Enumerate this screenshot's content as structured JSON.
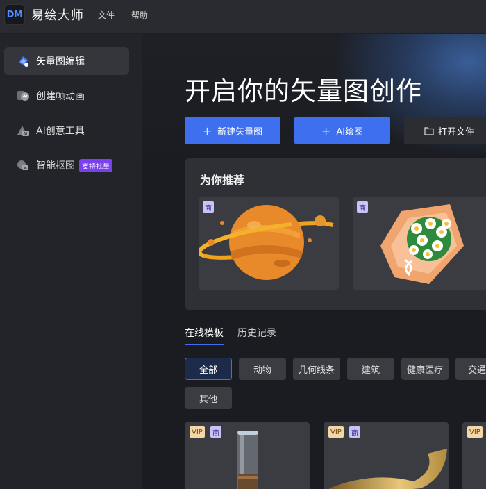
{
  "app": {
    "logo": "DM",
    "name": "易绘大师"
  },
  "menu": {
    "file": "文件",
    "help": "帮助"
  },
  "sidebar": {
    "items": [
      {
        "label": "矢量图编辑",
        "icon": "vector-edit-icon",
        "active": true
      },
      {
        "label": "创建帧动画",
        "icon": "frame-animation-icon",
        "active": false
      },
      {
        "label": "AI创意工具",
        "icon": "ai-tool-icon",
        "active": false
      },
      {
        "label": "智能抠图",
        "icon": "smart-cutout-icon",
        "active": false,
        "tag": "支持批量"
      }
    ]
  },
  "hero": {
    "title": "开启你的矢量图创作",
    "buttons": [
      {
        "label": "新建矢量图",
        "icon": "plus-icon"
      },
      {
        "label": "AI绘图",
        "icon": "plus-icon"
      },
      {
        "label": "打开文件",
        "icon": "folder-icon"
      }
    ]
  },
  "recommend": {
    "title": "为你推荐",
    "cards": [
      {
        "badge": "商",
        "image": "planet-illustration"
      },
      {
        "badge": "商",
        "image": "flower-bouquet-illustration"
      }
    ]
  },
  "tabs": [
    {
      "label": "在线模板",
      "active": true
    },
    {
      "label": "历史记录",
      "active": false
    }
  ],
  "categories": [
    "全部",
    "动物",
    "几何线条",
    "建筑",
    "健康医疗",
    "交通",
    "其他"
  ],
  "templates": [
    {
      "badges": [
        "VIP",
        "商"
      ],
      "image": "glass-tube-illustration"
    },
    {
      "badges": [
        "VIP",
        "商"
      ],
      "image": "gold-swoosh-illustration"
    },
    {
      "badges": [
        "VIP"
      ],
      "image": "template-thumbnail"
    }
  ],
  "colors": {
    "accent": "#3d6fee",
    "tag": "#7b3ff2",
    "vip": "#f3d7a6",
    "shang": "#c8c4f8"
  }
}
